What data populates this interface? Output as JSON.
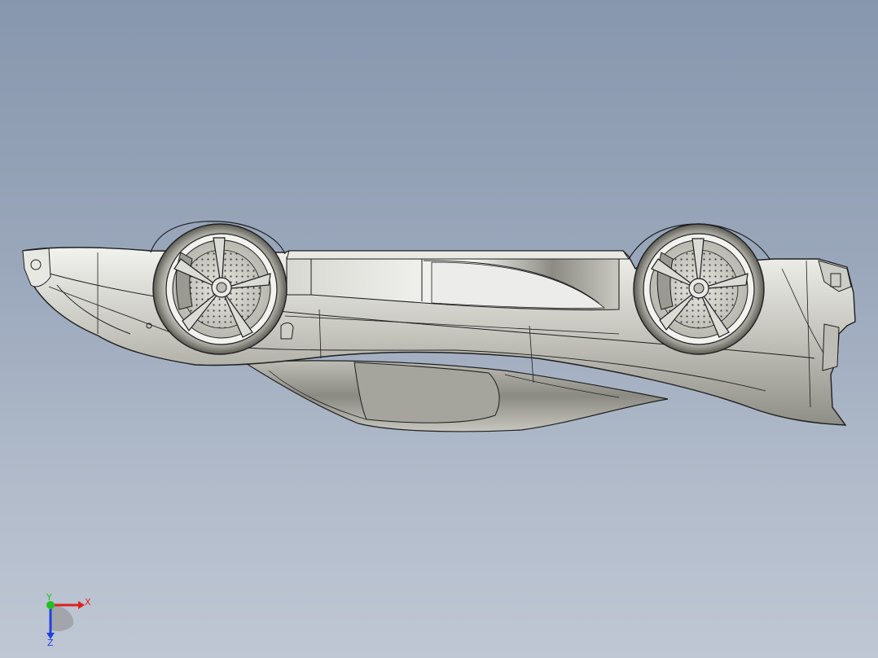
{
  "viewport": {
    "background_top": "#8797ad",
    "background_bottom": "#bfc7d4",
    "model_description_icon": "car-body-upside-down"
  },
  "model": {
    "body_color": "#d9d9d3",
    "edge_color": "#1e1e1e",
    "wheel_count": 2
  },
  "triad": {
    "x_label": "X",
    "y_label": "Y",
    "z_label": "Z",
    "x_color": "#e02020",
    "y_color": "#20c020",
    "z_color": "#2040e0"
  }
}
